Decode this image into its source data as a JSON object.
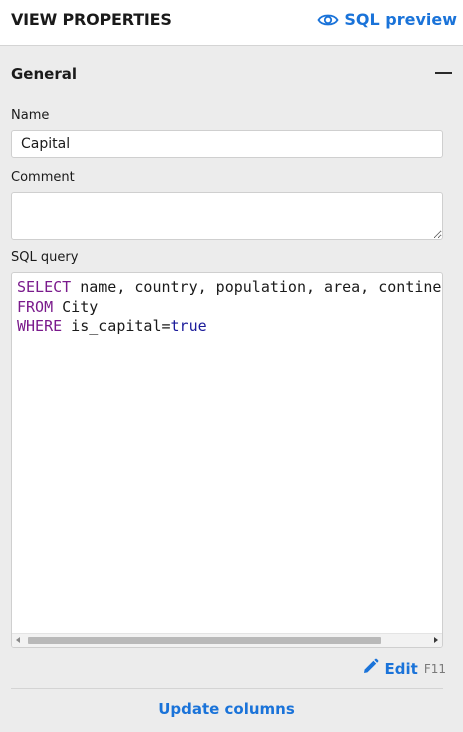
{
  "header": {
    "title": "VIEW PROPERTIES",
    "sql_preview_label": "SQL preview"
  },
  "section": {
    "title": "General"
  },
  "fields": {
    "name_label": "Name",
    "name_value": "Capital",
    "comment_label": "Comment",
    "comment_value": "",
    "sql_label": "SQL query"
  },
  "sql": {
    "line1_kw": "SELECT",
    "line1_rest": " name, country, population, area, continent",
    "line2_kw": "FROM",
    "line2_rest": " City",
    "line3_kw": "WHERE",
    "line3_rest": " is_capital=",
    "line3_bool": "true"
  },
  "actions": {
    "edit_label": "Edit",
    "edit_shortcut": "F11",
    "update_columns_label": "Update columns"
  },
  "colors": {
    "accent": "#1a73d9",
    "keyword": "#7a1a8c",
    "boolean": "#1a1a9a",
    "panel_bg": "#ececec"
  },
  "icons": {
    "sql_preview": "eye-icon",
    "collapse": "minus-icon",
    "edit": "pencil-icon"
  }
}
